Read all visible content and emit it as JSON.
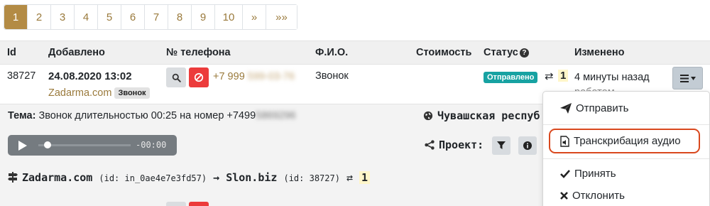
{
  "pagination": {
    "pages": [
      "1",
      "2",
      "3",
      "4",
      "5",
      "6",
      "7",
      "8",
      "9",
      "10",
      "»",
      "»»"
    ],
    "active": "1"
  },
  "table": {
    "headers": {
      "id": "Id",
      "added": "Добавлено",
      "phone": "№ телефона",
      "fio": "Ф.И.О.",
      "cost": "Стоимость",
      "status": "Статус",
      "changed": "Изменено"
    }
  },
  "row": {
    "id": "38727",
    "date": "24.08.2020 13:02",
    "source": "Zadarma.com",
    "source_badge": "Звонок",
    "phone_prefix": "+7 999",
    "phone_hidden": "599-03-76",
    "fio": "Звонок",
    "status_badge": "Отправлено",
    "swap_symbol": "⇄",
    "count": "1",
    "changed": "4 минуты назад",
    "changed_2": "роботом"
  },
  "details": {
    "topic_label": "Тема:",
    "topic_text": "Звонок длительностью 00:25 на номер +7499",
    "topic_hidden": "5869296",
    "region": "Чувашская респуб",
    "player_time": "-00:00",
    "project_label": "Проект:",
    "route": {
      "from": "Zadarma.com",
      "from_id": "(id: in_0ae4e7e3fd57)",
      "arrow": "→",
      "to": "Slon.biz",
      "to_id": "(id: 38727)",
      "swap": "⇄",
      "count": "1"
    }
  },
  "dropdown": {
    "items": [
      "Отправить",
      "Транскрибация аудио",
      "Принять",
      "Отклонить"
    ],
    "icons": [
      "paper-plane-icon",
      "audio-file-icon",
      "check-icon",
      "x-icon"
    ]
  },
  "colors": {
    "accent": "#b38b45",
    "link": "#9a7a3c",
    "danger": "#ec3b3b",
    "success": "#17a2a2",
    "highlight": "#d9481e"
  }
}
